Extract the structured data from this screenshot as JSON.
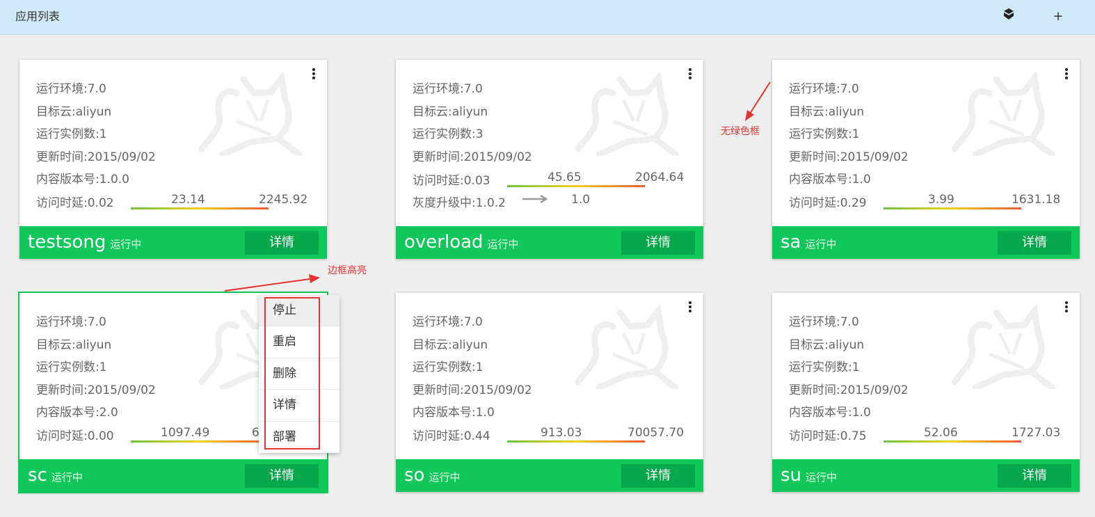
{
  "header": {
    "title": "应用列表",
    "box_icon": "box-icon",
    "add_icon": "+"
  },
  "colors": {
    "accent_green": "#0fc75b",
    "detail_button": "#07a84c",
    "annotation_red": "#e53333"
  },
  "cards": [
    {
      "info": [
        "运行环境:7.0",
        "目标云:aliyun",
        "运行实例数:1",
        "更新时间:2015/09/02",
        "内容版本号:1.0.0"
      ],
      "latency_label": "访问时延:0.02",
      "mid": "23.14",
      "max": "2245.92",
      "name": "testsong",
      "status": "运行中",
      "detail": "详情"
    },
    {
      "info": [
        "运行环境:7.0",
        "目标云:aliyun",
        "运行实例数:3",
        "更新时间:2015/09/02"
      ],
      "latency_label": "访问时延:0.03",
      "mid": "45.65",
      "max": "2064.64",
      "gray_label": "灰度升级中:1.0.2",
      "gray_target": "1.0",
      "name": "overload",
      "status": "运行中",
      "detail": "详情"
    },
    {
      "info": [
        "运行环境:7.0",
        "目标云:aliyun",
        "运行实例数:1",
        "更新时间:2015/09/02",
        "内容版本号:1.0"
      ],
      "latency_label": "访问时延:0.29",
      "mid": "3.99",
      "max": "1631.18",
      "name": "sa",
      "status": "运行中",
      "detail": "详情"
    },
    {
      "info": [
        "运行环境:7.0",
        "目标云:aliyun",
        "运行实例数:1",
        "更新时间:2015/09/02",
        "内容版本号:2.0"
      ],
      "latency_label": "访问时延:0.00",
      "mid": "1097.49",
      "max": "6",
      "name": "sc",
      "status": "运行中",
      "detail": "详情"
    },
    {
      "info": [
        "运行环境:7.0",
        "目标云:aliyun",
        "运行实例数:1",
        "更新时间:2015/09/02",
        "内容版本号:1.0"
      ],
      "latency_label": "访问时延:0.44",
      "mid": "913.03",
      "max": "70057.70",
      "name": "so",
      "status": "运行中",
      "detail": "详情"
    },
    {
      "info": [
        "运行环境:7.0",
        "目标云:aliyun",
        "运行实例数:1",
        "更新时间:2015/09/02",
        "内容版本号:1.0"
      ],
      "latency_label": "访问时延:0.75",
      "mid": "52.06",
      "max": "1727.03",
      "name": "su",
      "status": "运行中",
      "detail": "详情"
    }
  ],
  "menu": {
    "items": [
      "停止",
      "重启",
      "删除",
      "详情",
      "部署"
    ]
  },
  "annotations": {
    "no_green_border": "无绿色框",
    "border_highlight": "边框高亮"
  }
}
